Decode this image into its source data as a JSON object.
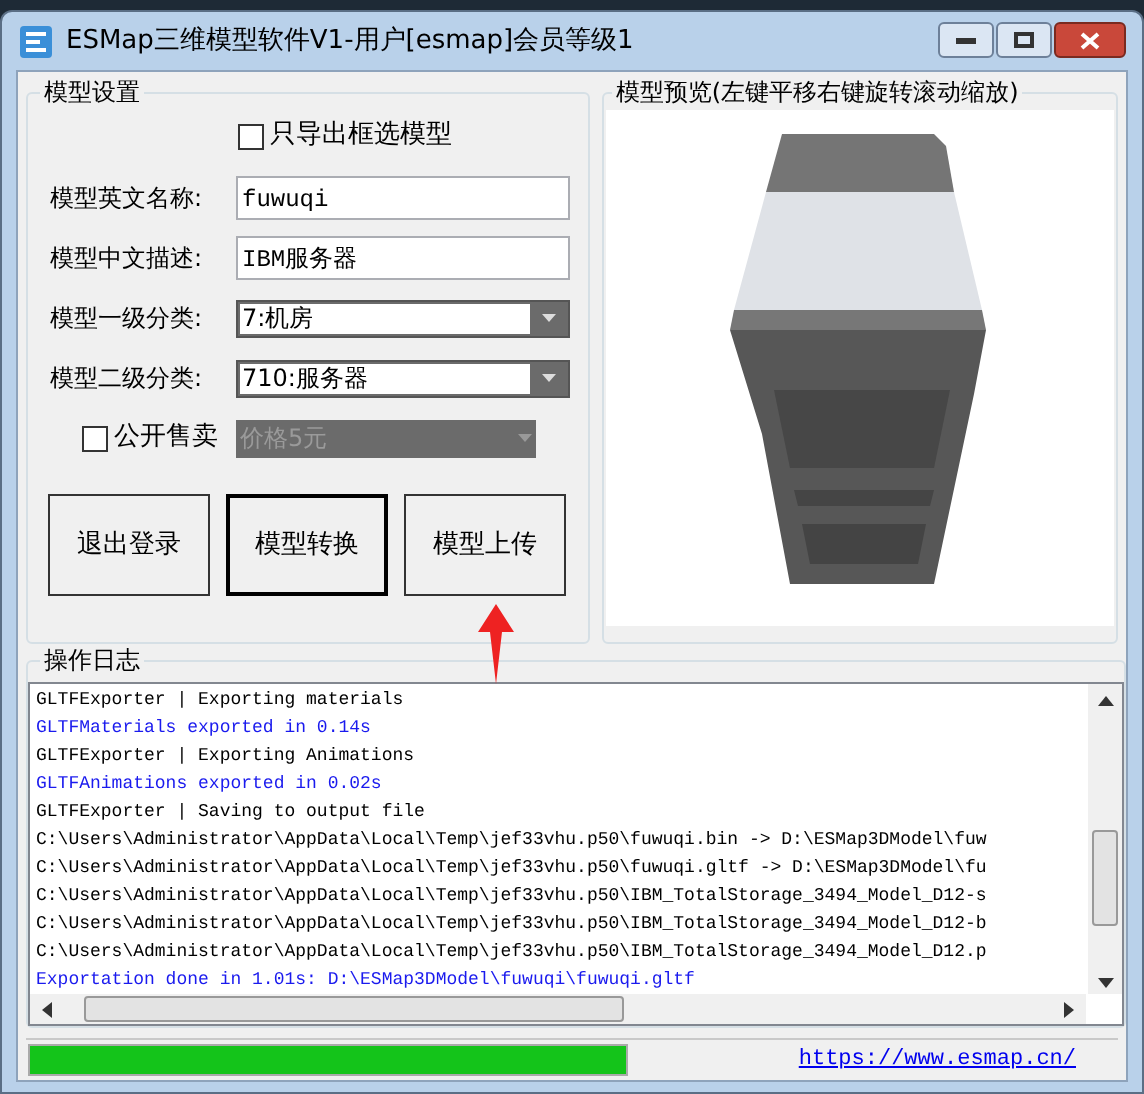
{
  "window": {
    "title": "ESMap三维模型软件V1-用户[esmap]会员等级1"
  },
  "settings": {
    "title": "模型设置",
    "export_selected": {
      "label": "只导出框选模型",
      "checked": false
    },
    "fields": [
      {
        "kind": "text",
        "label": "模型英文名称:",
        "value": "fuwuqi"
      },
      {
        "kind": "text",
        "label": "模型中文描述:",
        "value": "IBM服务器"
      },
      {
        "kind": "combo",
        "label": "模型一级分类:",
        "value": "7:机房"
      },
      {
        "kind": "combo",
        "label": "模型二级分类:",
        "value": "710:服务器"
      }
    ],
    "public_sale": {
      "label": "公开售卖",
      "checked": false
    },
    "price": {
      "value": "价格5元",
      "disabled": true
    },
    "buttons": [
      {
        "label": "退出登录",
        "default": false
      },
      {
        "label": "模型转换",
        "default": true
      },
      {
        "label": "模型上传",
        "default": false
      }
    ]
  },
  "preview": {
    "title": "模型预览(左键平移右键旋转滚动缩放)"
  },
  "log": {
    "title": "操作日志",
    "lines": [
      {
        "kind": "plain",
        "text": "GLTFExporter | Exporting materials"
      },
      {
        "kind": "info",
        "text": "GLTFMaterials exported in 0.14s"
      },
      {
        "kind": "plain",
        "text": "GLTFExporter | Exporting Animations"
      },
      {
        "kind": "info",
        "text": "GLTFAnimations exported in 0.02s"
      },
      {
        "kind": "plain",
        "text": "GLTFExporter | Saving to output file"
      },
      {
        "kind": "plain",
        "text": "C:\\Users\\Administrator\\AppData\\Local\\Temp\\jef33vhu.p50\\fuwuqi.bin -> D:\\ESMap3DModel\\fuw"
      },
      {
        "kind": "plain",
        "text": "C:\\Users\\Administrator\\AppData\\Local\\Temp\\jef33vhu.p50\\fuwuqi.gltf -> D:\\ESMap3DModel\\fu"
      },
      {
        "kind": "plain",
        "text": "C:\\Users\\Administrator\\AppData\\Local\\Temp\\jef33vhu.p50\\IBM_TotalStorage_3494_Model_D12-s"
      },
      {
        "kind": "plain",
        "text": "C:\\Users\\Administrator\\AppData\\Local\\Temp\\jef33vhu.p50\\IBM_TotalStorage_3494_Model_D12-b"
      },
      {
        "kind": "plain",
        "text": "C:\\Users\\Administrator\\AppData\\Local\\Temp\\jef33vhu.p50\\IBM_TotalStorage_3494_Model_D12.p"
      },
      {
        "kind": "info",
        "text": "Exportation done in 1.01s: D:\\ESMap3DModel\\fuwuqi\\fuwuqi.gltf"
      }
    ]
  },
  "status_bar": {
    "progress": {
      "level": 1
    },
    "link": "https://www.esmap.cn/"
  }
}
